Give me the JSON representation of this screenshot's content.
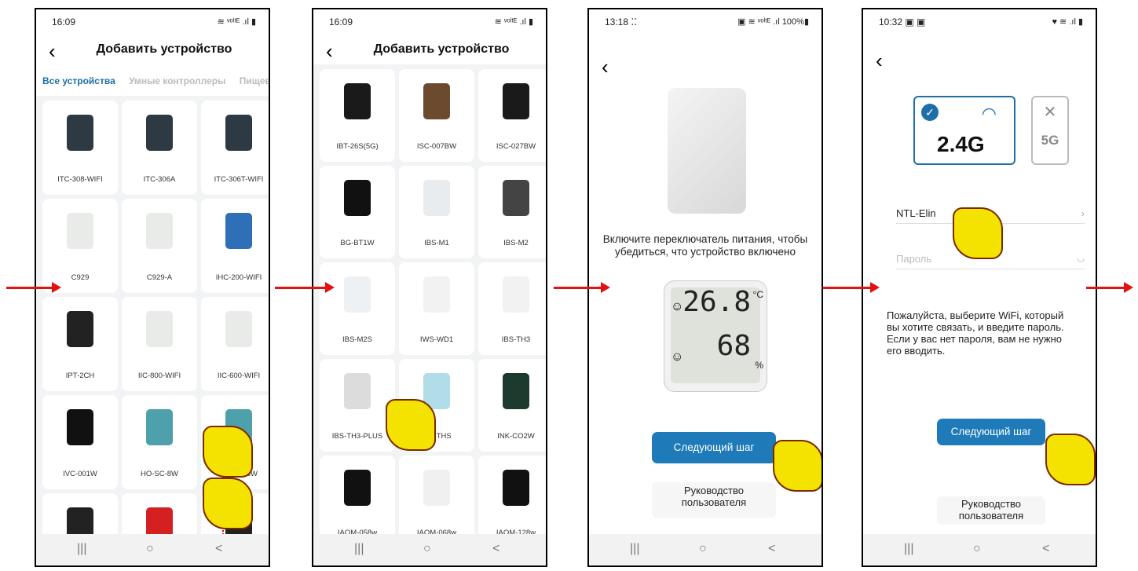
{
  "screen1": {
    "time": "16:09",
    "status_icons": "≋ ᵛᵒˡᵗᴱ .ıl ▮",
    "title": "Добавить устройство",
    "tabs": [
      "Все устройства",
      "Умные контроллеры",
      "Пищевы"
    ],
    "devices": [
      {
        "label": "ITC-308-WIFI",
        "color": "#2e3a43"
      },
      {
        "label": "ITC-306A",
        "color": "#2e3a43"
      },
      {
        "label": "ITC-306T-WIFI",
        "color": "#2e3a43"
      },
      {
        "label": "C929",
        "color": "#e8ebe7"
      },
      {
        "label": "C929-A",
        "color": "#e8ebe7"
      },
      {
        "label": "IHC-200-WIFI",
        "color": "#2f6fb8"
      },
      {
        "label": "IPT-2CH",
        "color": "#222222"
      },
      {
        "label": "IIC-800-WIFI",
        "color": "#e8ebe7"
      },
      {
        "label": "IIC-600-WIFI",
        "color": "#e8ebe7"
      },
      {
        "label": "IVC-001W",
        "color": "#111111"
      },
      {
        "label": "HO-SC-8W",
        "color": "#4ea0ab"
      },
      {
        "label": "HO-SC-6W",
        "color": "#4ea0ab"
      },
      {
        "label": "",
        "color": "#222222"
      },
      {
        "label": "",
        "color": "#d42020"
      },
      {
        "label": "",
        "color": "#222222"
      }
    ]
  },
  "screen2": {
    "time": "16:09",
    "status_icons": "≋ ᵛᵒˡᵗᴱ .ıl ▮",
    "title": "Добавить устройство",
    "devices": [
      {
        "label": "IBT-26S(5G)",
        "color": "#1a1a1a"
      },
      {
        "label": "ISC-007BW",
        "color": "#6b4a2e"
      },
      {
        "label": "ISC-027BW",
        "color": "#1a1a1a"
      },
      {
        "label": "BG-BT1W",
        "color": "#111111"
      },
      {
        "label": "IBS-M1",
        "color": "#e9ecef"
      },
      {
        "label": "IBS-M2",
        "color": "#444444"
      },
      {
        "label": "IBS-M2S",
        "color": "#eef1f4"
      },
      {
        "label": "IWS-WD1",
        "color": "#f2f2f2"
      },
      {
        "label": "IBS-TH3",
        "color": "#f2f2f2"
      },
      {
        "label": "IBS-TH3-PLUS",
        "color": "#dcdcdc"
      },
      {
        "label": "IBS-THS",
        "color": "#b0dde8"
      },
      {
        "label": "INK-CO2W",
        "color": "#1d3a2e"
      },
      {
        "label": "IAQM-058w",
        "color": "#111111"
      },
      {
        "label": "IAQM-068w",
        "color": "#f0f0f0"
      },
      {
        "label": "IAQM-128w",
        "color": "#111111"
      }
    ]
  },
  "screen3": {
    "time": "13:18 ⁚⁚",
    "status_icons": "▣ ≋ ᵛᵒˡᵗᴱ .ıl 100%▮",
    "instruction": "Включите переключатель питания, чтобы убедиться, что устройство включено",
    "temp": "26.8",
    "temp_unit": "°C",
    "humidity": "68",
    "humidity_unit": "%",
    "next_button": "Следующий шаг",
    "guide_button": "Руководство пользователя"
  },
  "screen4": {
    "time": "10:32 ▣ ▣",
    "status_icons": "♥ ≋ .ıl ▮",
    "band_24": "2.4G",
    "band_5": "5G",
    "ssid": "NTL-Elin",
    "password_placeholder": "Пароль",
    "hint": "Пожалуйста, выберите WiFi, который вы хотите связать, и введите пароль. Если у вас нет пароля, вам не нужно его вводить.",
    "next_button": "Следующий шаг",
    "guide_button": "Руководство пользователя"
  },
  "colors": {
    "accent": "#1e7ab8",
    "arrow": "#e51010",
    "hand": "#f4e200"
  },
  "navbar": {
    "recent": "|||",
    "home": "○",
    "back": "<"
  }
}
